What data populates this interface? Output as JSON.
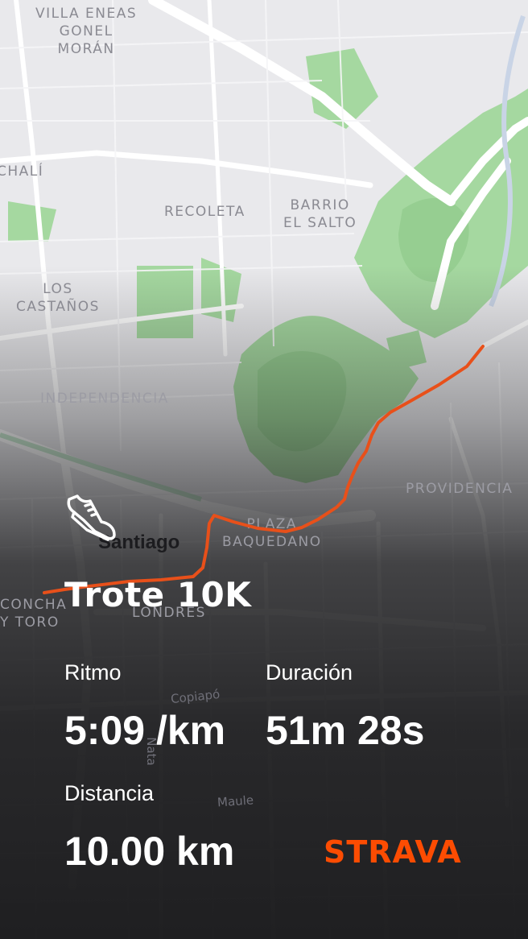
{
  "map": {
    "neighborhoods": {
      "villa_eneas": "VILLA ENEAS\nGONEL\nMORÁN",
      "chali": "CHALÍ",
      "recoleta": "RECOLETA",
      "barrio_el_salto": "BARRIO\nEL SALTO",
      "los_castanos": "LOS\nCASTAÑOS",
      "independencia": "INDEPENDENCIA",
      "providencia": "PROVIDENCIA",
      "plaza_baquedano": "PLAZA\nBAQUEDANO",
      "concha_y_toro": "CONCHA\nY TORO",
      "londres": "LONDRES"
    },
    "city": "Santiago",
    "streets": {
      "copiapo": "Copiapó",
      "maule": "Maule",
      "natal": "Nata"
    },
    "colors": {
      "route": "#e8501a",
      "park": "#9fd59a",
      "road": "#ffffff",
      "base": "#e9e9ec"
    }
  },
  "activity": {
    "icon": "running-shoe-icon",
    "title": "Trote 10K",
    "stats": {
      "pace_label": "Ritmo",
      "pace_value": "5:09 /km",
      "duration_label": "Duración",
      "duration_value": "51m 28s",
      "distance_label": "Distancia",
      "distance_value": "10.00 km"
    }
  },
  "brand": {
    "name": "STRAVA",
    "color": "#fc4c02"
  }
}
